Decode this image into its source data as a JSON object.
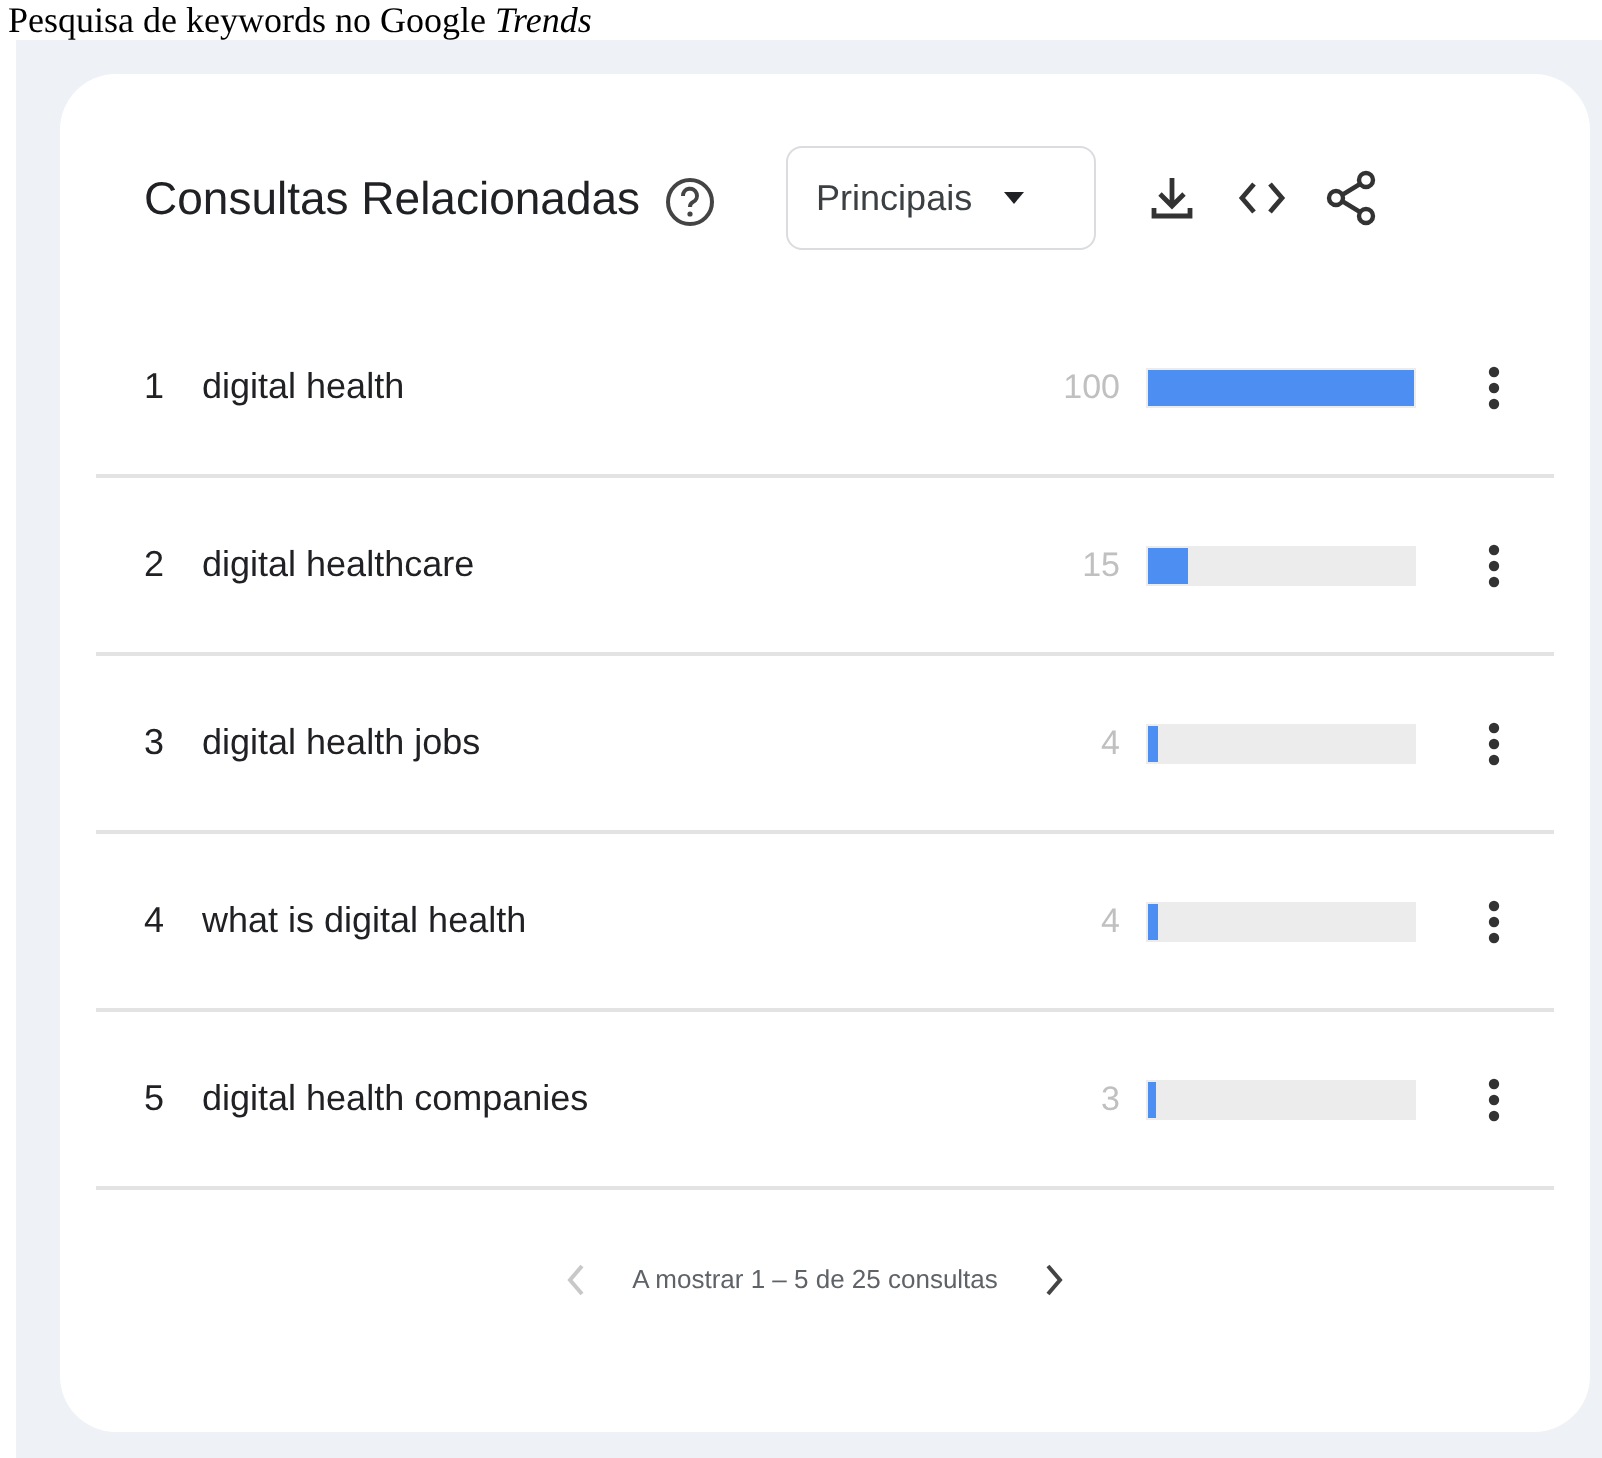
{
  "caption": "Pesquisa de keywords no Google *Trends*",
  "card": {
    "title": "Consultas Relacionadas",
    "dropdown": {
      "value": "Principais"
    },
    "rows": [
      {
        "rank": "1",
        "query": "digital health",
        "value": "100",
        "level": 1.0
      },
      {
        "rank": "2",
        "query": "digital healthcare",
        "value": "15",
        "level": 0.15
      },
      {
        "rank": "3",
        "query": "digital health jobs",
        "value": "4",
        "level": 0.04
      },
      {
        "rank": "4",
        "query": "what is digital health",
        "value": "4",
        "level": 0.04
      },
      {
        "rank": "5",
        "query": "digital health companies",
        "value": "3",
        "level": 0.03
      }
    ],
    "pagination": {
      "text": "A mostrar 1 – 5 de 25 consultas",
      "prev_disabled": true,
      "next_disabled": false
    }
  }
}
